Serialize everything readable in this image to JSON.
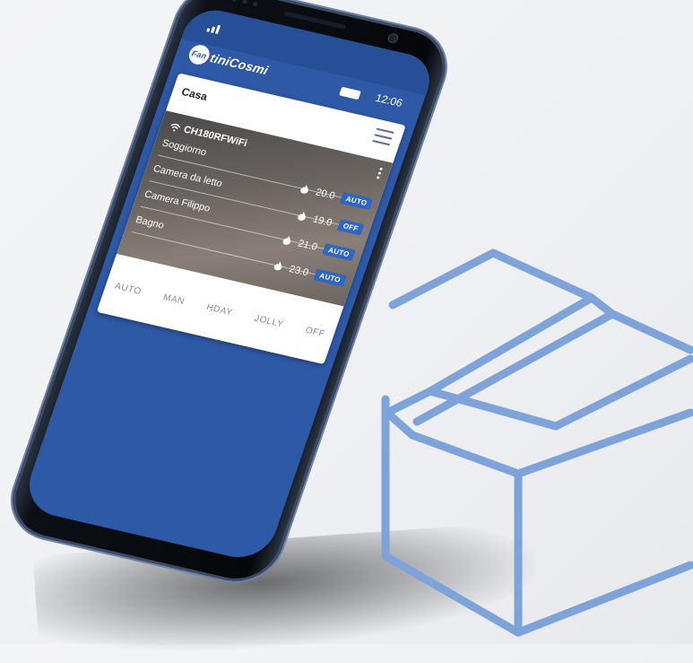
{
  "status": {
    "time": "12:06"
  },
  "brand": {
    "logo_mark": "Fan",
    "logo_text": "tiniCosmi"
  },
  "card": {
    "title": "Casa",
    "device_name": "CH180RFWiFi",
    "zones": [
      {
        "name": "Soggiorno",
        "temp": "20.0",
        "mode": "AUTO"
      },
      {
        "name": "Camera da letto",
        "temp": "19.0",
        "mode": "OFF"
      },
      {
        "name": "Camera Filippo",
        "temp": "21.0",
        "mode": "AUTO"
      },
      {
        "name": "Bagno",
        "temp": "23.0",
        "mode": "AUTO"
      }
    ]
  },
  "mode_tabs": [
    "AUTO",
    "MAN",
    "HDAY",
    "JOLLY",
    "OFF"
  ],
  "icons": {
    "signal": "signal-icon",
    "battery": "battery-icon",
    "menu": "hamburger-menu-icon",
    "wifi": "wifi-icon",
    "kebab": "kebab-menu-icon",
    "flame": "flame-icon"
  },
  "colors": {
    "screen_blue": "#2e59a6",
    "badge_blue": "#2e66c0",
    "box_outline": "#7ea3d8"
  }
}
